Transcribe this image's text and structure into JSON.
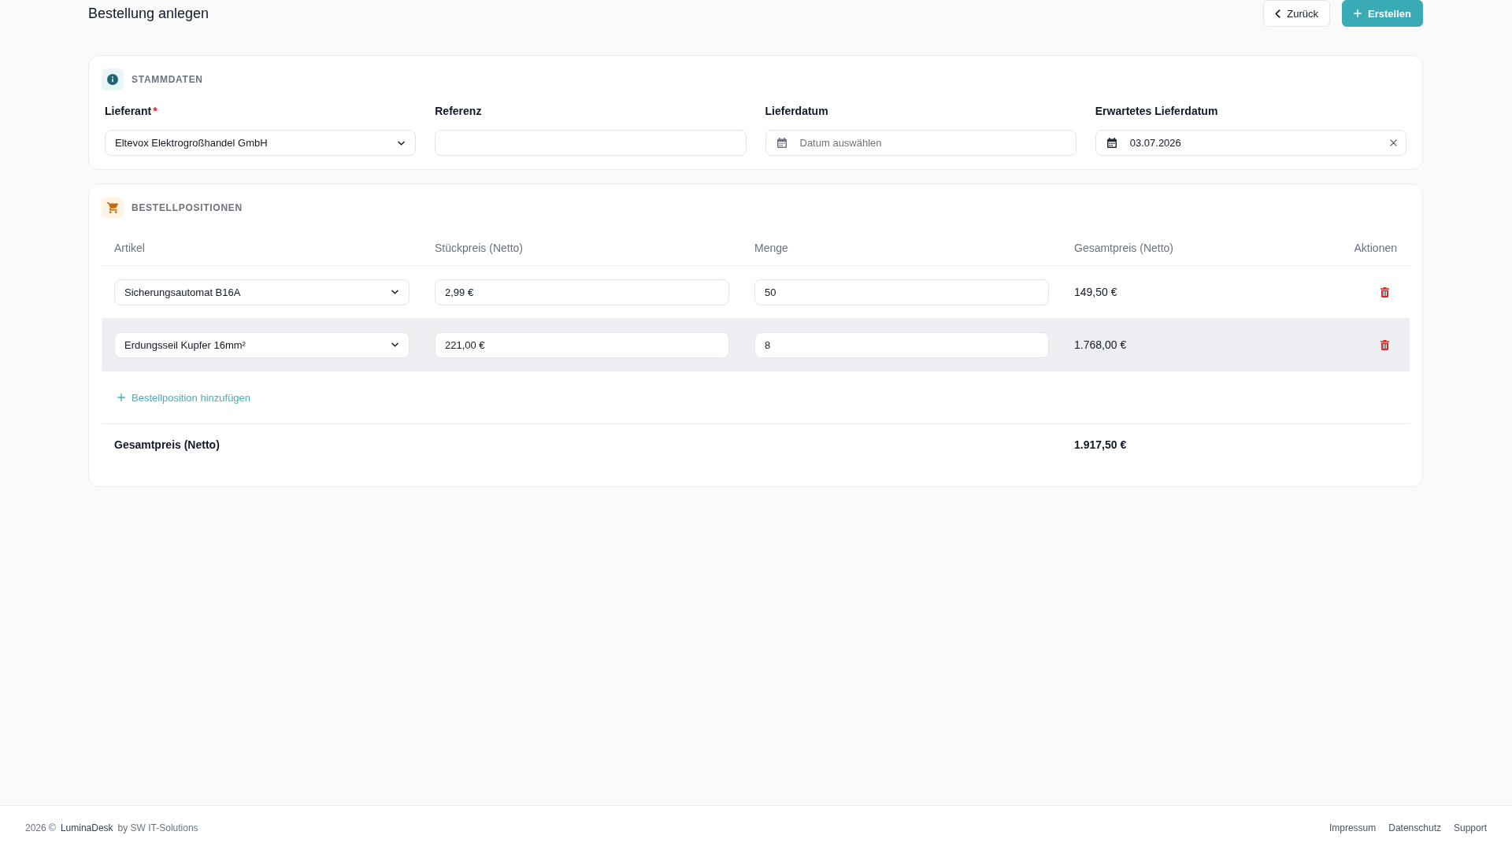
{
  "page": {
    "title": "Bestellung anlegen"
  },
  "actions": [
    {
      "label": "Zurück",
      "kind": "back"
    },
    {
      "label": "Erstellen",
      "kind": "primary"
    }
  ],
  "master_data": {
    "title": "STAMMDATEN",
    "fields": [
      {
        "label": "Lieferant",
        "required_mark": "*",
        "kind": "select",
        "value": "Eltevox Elektrogroßhandel GmbH"
      },
      {
        "label": "Referenz",
        "kind": "text"
      },
      {
        "label": "Lieferdatum",
        "kind": "date",
        "placeholder": "Datum auswählen"
      },
      {
        "label": "Erwartetes Lieferdatum",
        "kind": "date",
        "value": "03.07.2026"
      }
    ]
  },
  "order_items": {
    "title": "BESTELLPOSITIONEN",
    "columns": [
      "Artikel",
      "Stückpreis (Netto)",
      "Menge",
      "Gesamtpreis (Netto)",
      "Aktionen"
    ],
    "rows": [
      {
        "article": "Sicherungsautomat B16A",
        "unit_price": "2,99 €",
        "quantity": "50",
        "total": "149,50 €",
        "highlighted": false
      },
      {
        "article": "Erdungsseil Kupfer 16mm²",
        "unit_price": "221,00 €",
        "quantity": "8",
        "total": "1.768,00 €",
        "highlighted": true
      }
    ],
    "add_button": "Bestellposition hinzufügen",
    "summary": {
      "label": "Gesamtpreis (Netto)",
      "value": "1.917,50 €"
    }
  },
  "footer": {
    "copyright": "2026 ©",
    "brand": "LuminaDesk",
    "credit": "by SW IT-Solutions",
    "links": [
      "Impressum",
      "Datenschutz",
      "Support"
    ]
  }
}
